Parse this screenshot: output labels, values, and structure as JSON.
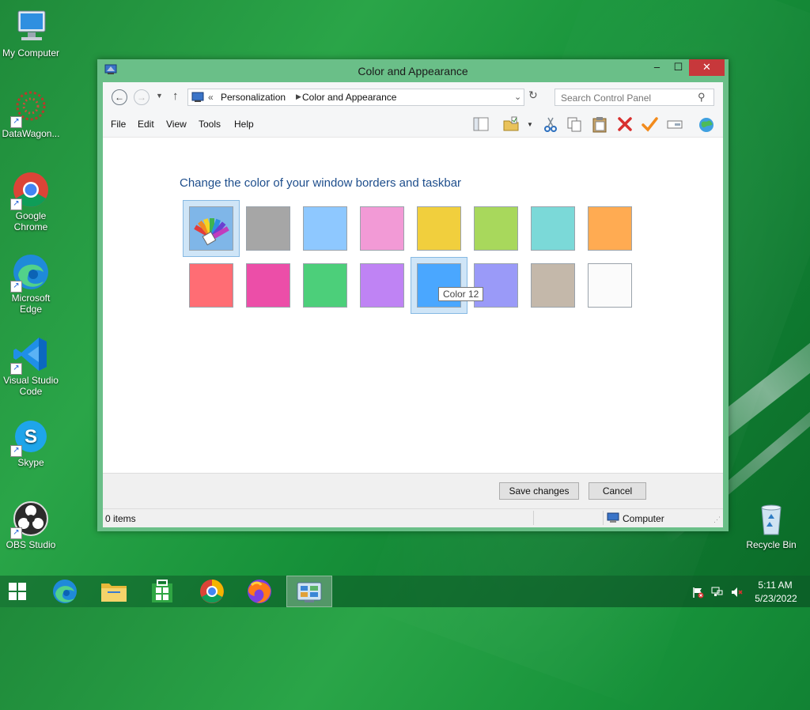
{
  "desktop": {
    "icons": [
      {
        "label": "My Computer"
      },
      {
        "label": "DataWagon..."
      },
      {
        "label": "Google Chrome"
      },
      {
        "label": "Microsoft Edge"
      },
      {
        "label": "Visual Studio Code"
      },
      {
        "label": "Skype"
      },
      {
        "label": "OBS Studio"
      },
      {
        "label": "Recycle Bin"
      }
    ]
  },
  "window": {
    "title": "Color and Appearance",
    "controls": {
      "minimize": "–",
      "maximize": "☐",
      "close": "✕"
    },
    "breadcrumb": {
      "prefix": "«",
      "items": [
        "Personalization",
        "Color and Appearance"
      ]
    },
    "search": {
      "placeholder": "Search Control Panel"
    },
    "menu": [
      "File",
      "Edit",
      "View",
      "Tools",
      "Help"
    ],
    "heading": "Change the color of your window borders and taskbar",
    "swatches": [
      {
        "color": "custom-palette",
        "selected": true
      },
      {
        "color": "#a6a6a6"
      },
      {
        "color": "#8ec8ff"
      },
      {
        "color": "#f29ad6"
      },
      {
        "color": "#f1cf3d"
      },
      {
        "color": "#a8d85c"
      },
      {
        "color": "#7bd9d8"
      },
      {
        "color": "#ffab52"
      },
      {
        "color": "#ff6d74"
      },
      {
        "color": "#ec4ea8"
      },
      {
        "color": "#4ccf7a"
      },
      {
        "color": "#bf83f4"
      },
      {
        "color": "#4aa7ff",
        "hovered": true
      },
      {
        "color": "#9a9af8"
      },
      {
        "color": "#c4b8aa"
      },
      {
        "color": "#fbfbfb"
      }
    ],
    "tooltip": "Color 12",
    "buttons": {
      "save": "Save changes",
      "cancel": "Cancel"
    },
    "status": {
      "items": "0 items",
      "location": "Computer"
    }
  },
  "taskbar": {
    "apps": [
      "start-icon",
      "edge-icon",
      "file-explorer-icon",
      "store-icon",
      "chrome-icon",
      "firefox-icon",
      "control-panel-icon"
    ],
    "clock": {
      "time": "5:11 AM",
      "date": "5/23/2022"
    }
  }
}
